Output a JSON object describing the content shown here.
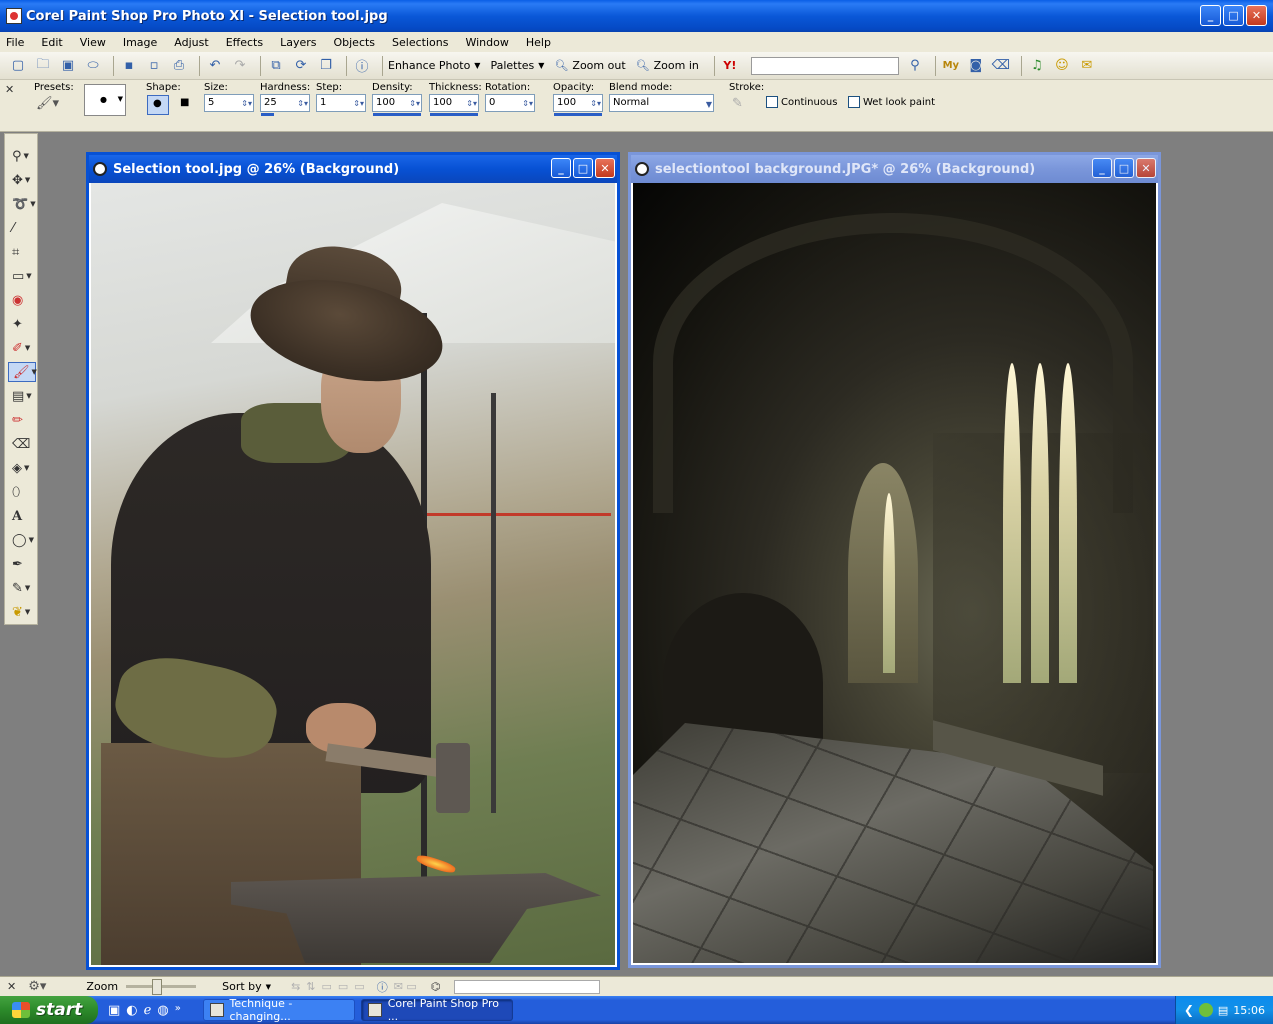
{
  "app": {
    "title": "Corel Paint Shop Pro Photo XI - Selection tool.jpg",
    "window_buttons": {
      "minimize": "_",
      "maximize": "□",
      "close": "✕"
    }
  },
  "menu": [
    "File",
    "Edit",
    "View",
    "Image",
    "Adjust",
    "Effects",
    "Layers",
    "Objects",
    "Selections",
    "Window",
    "Help"
  ],
  "toolbar": {
    "enhance_photo": "Enhance Photo",
    "palettes": "Palettes",
    "zoom_out": "Zoom out",
    "zoom_in": "Zoom in",
    "search_value": ""
  },
  "tool_options": {
    "presets_label": "Presets:",
    "shape_label": "Shape:",
    "size_label": "Size:",
    "size_value": "5",
    "hardness_label": "Hardness:",
    "hardness_value": "25",
    "step_label": "Step:",
    "step_value": "1",
    "density_label": "Density:",
    "density_value": "100",
    "thickness_label": "Thickness:",
    "thickness_value": "100",
    "rotation_label": "Rotation:",
    "rotation_value": "0",
    "opacity_label": "Opacity:",
    "opacity_value": "100",
    "blend_label": "Blend mode:",
    "blend_value": "Normal",
    "stroke_label": "Stroke:",
    "continuous_label": "Continuous",
    "wet_look_label": "Wet look paint"
  },
  "documents": [
    {
      "title": "Selection tool.jpg @  26% (Background)",
      "active": true
    },
    {
      "title": "selectiontool background.JPG* @  26% (Background)",
      "active": false
    }
  ],
  "bottom_bar": {
    "zoom_label": "Zoom",
    "sort_label": "Sort by",
    "field_value": ""
  },
  "taskbar": {
    "start_label": "start",
    "tasks": [
      "Technique - changing...",
      "Corel Paint Shop Pro ..."
    ],
    "clock": "15:06"
  },
  "colors": {
    "title_blue": "#0751d4",
    "inactive_blue": "#7a96da",
    "start_green": "#2c8a2a",
    "menu_bg": "#ece9d8",
    "workspace": "#7f7f7f"
  }
}
